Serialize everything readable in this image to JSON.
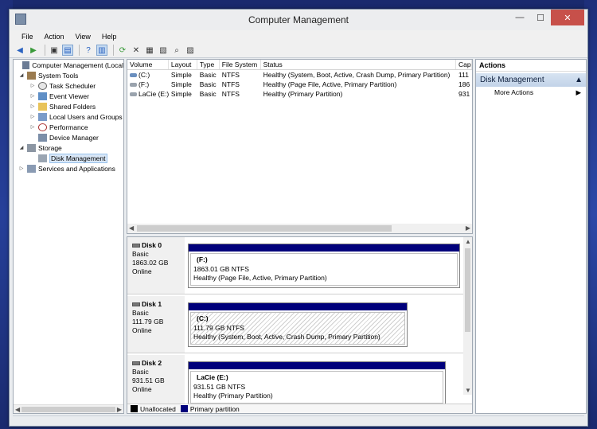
{
  "window": {
    "title": "Computer Management"
  },
  "winbtns": {
    "minimize": "—",
    "maximize": "☐",
    "close": "✕"
  },
  "menu": [
    "File",
    "Action",
    "View",
    "Help"
  ],
  "tree": {
    "root": "Computer Management (Local",
    "system_tools": "System Tools",
    "task_scheduler": "Task Scheduler",
    "event_viewer": "Event Viewer",
    "shared_folders": "Shared Folders",
    "local_users": "Local Users and Groups",
    "performance": "Performance",
    "device_manager": "Device Manager",
    "storage": "Storage",
    "disk_management": "Disk Management",
    "services": "Services and Applications"
  },
  "volume_list": {
    "headers": [
      "Volume",
      "Layout",
      "Type",
      "File System",
      "Status",
      "Cap"
    ],
    "rows": [
      [
        "(C:)",
        "Simple",
        "Basic",
        "NTFS",
        "Healthy (System, Boot, Active, Crash Dump, Primary Partition)",
        "111"
      ],
      [
        "(F:)",
        "Simple",
        "Basic",
        "NTFS",
        "Healthy (Page File, Active, Primary Partition)",
        "186"
      ],
      [
        "LaCie (E:)",
        "Simple",
        "Basic",
        "NTFS",
        "Healthy (Primary Partition)",
        "931"
      ]
    ]
  },
  "disks": [
    {
      "name": "Disk 0",
      "type": "Basic",
      "size": "1863.02 GB",
      "state": "Online",
      "partition": {
        "label": "(F:)",
        "size": "1863.01 GB NTFS",
        "status": "Healthy (Page File, Active, Primary Partition)"
      }
    },
    {
      "name": "Disk 1",
      "type": "Basic",
      "size": "111.79 GB",
      "state": "Online",
      "partition": {
        "label": "(C:)",
        "size": "111.79 GB NTFS",
        "status": "Healthy (System, Boot, Active, Crash Dump, Primary Partition)"
      }
    },
    {
      "name": "Disk 2",
      "type": "Basic",
      "size": "931.51 GB",
      "state": "Online",
      "partition": {
        "label": "LaCie  (E:)",
        "size": "931.51 GB NTFS",
        "status": "Healthy (Primary Partition)"
      }
    }
  ],
  "legend": {
    "unallocated": "Unallocated",
    "primary": "Primary partition",
    "unallocated_color": "#000000",
    "primary_color": "#00007b"
  },
  "actions": {
    "header": "Actions",
    "section": "Disk Management",
    "more": "More Actions"
  }
}
